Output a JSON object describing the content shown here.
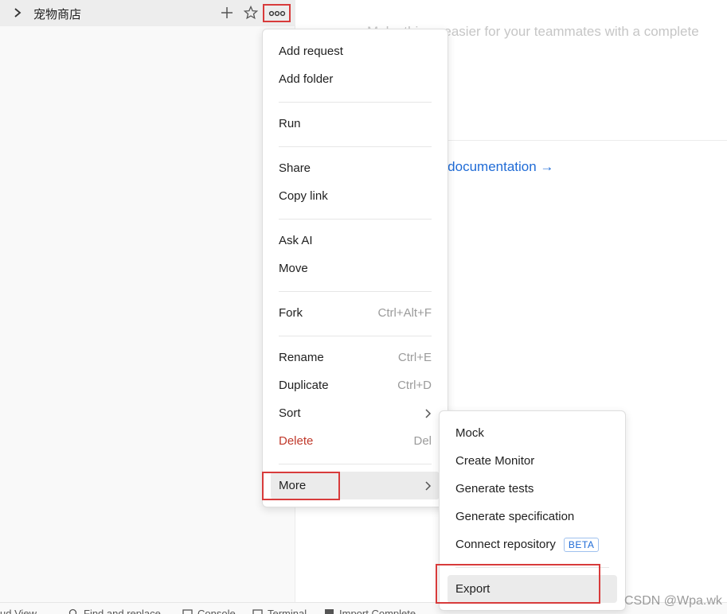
{
  "sidebar": {
    "collection_name": "宠物商店"
  },
  "main": {
    "hint": "Make things easier for your teammates with a complete",
    "doc_link": "e documentation →"
  },
  "menu": {
    "add_request": "Add request",
    "add_folder": "Add folder",
    "run": "Run",
    "share": "Share",
    "copy_link": "Copy link",
    "ask_ai": "Ask AI",
    "move": "Move",
    "fork": "Fork",
    "fork_shortcut": "Ctrl+Alt+F",
    "rename": "Rename",
    "rename_shortcut": "Ctrl+E",
    "duplicate": "Duplicate",
    "duplicate_shortcut": "Ctrl+D",
    "sort": "Sort",
    "delete": "Delete",
    "delete_shortcut": "Del",
    "more": "More"
  },
  "submenu": {
    "mock": "Mock",
    "create_monitor": "Create Monitor",
    "generate_tests": "Generate tests",
    "generate_specification": "Generate specification",
    "connect_repository": "Connect repository",
    "beta_badge": "BETA",
    "export": "Export"
  },
  "statusbar": {
    "view": "ud View",
    "find_replace": "Find and replace",
    "console": "Console",
    "terminal": "Terminal",
    "import": "Import Complete"
  },
  "watermark": "CSDN @Wpa.wk",
  "colors": {
    "highlight_border": "#d83b3b",
    "link_blue": "#1f6bd6",
    "danger_red": "#c0392b"
  }
}
